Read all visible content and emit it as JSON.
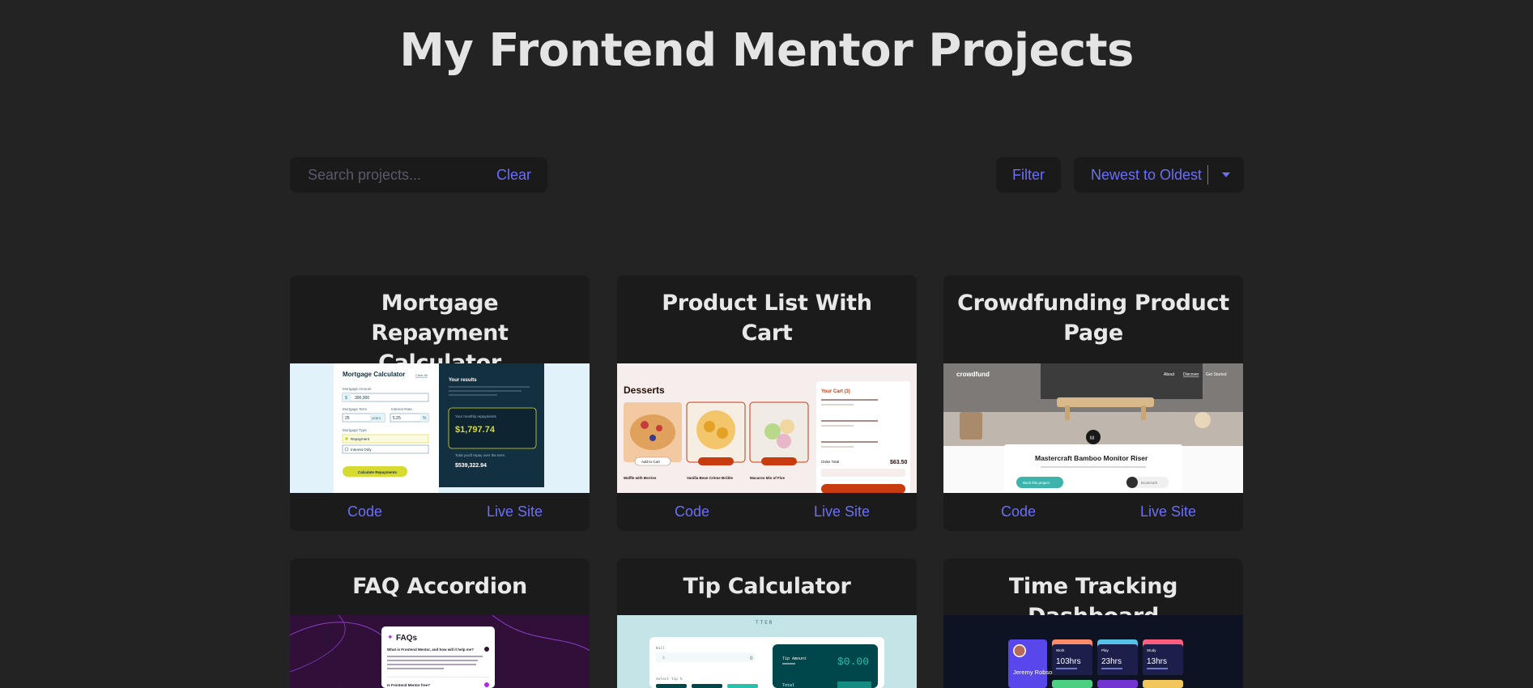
{
  "page": {
    "title": "My Frontend Mentor Projects"
  },
  "controls": {
    "search_placeholder": "Search projects...",
    "clear_label": "Clear",
    "filter_label": "Filter",
    "sort_selected": "Newest to Oldest"
  },
  "colors": {
    "background": "#232323",
    "card": "#1b1b1b",
    "accent": "#6b6ff7",
    "text": "#e6e6e6"
  },
  "projects": [
    {
      "title": "Mortgage Repayment Calculator",
      "code_label": "Code",
      "live_label": "Live Site",
      "preview": {
        "heading": "Mortgage Calculator",
        "clear_all": "Clear All",
        "amount_label": "Mortgage Amount",
        "amount_value": "300,000",
        "term_label": "Mortgage Term",
        "term_value": "25",
        "term_unit": "years",
        "rate_label": "Interest Rate",
        "rate_value": "5.25",
        "type_label": "Mortgage Type",
        "type_option_1": "Repayment",
        "type_option_2": "Interest Only",
        "button": "Calculate Repayments",
        "results_title": "Your results",
        "monthly_label": "Your monthly repayments",
        "monthly_value": "$1,797.74",
        "total_label": "Total you'll repay over the term",
        "total_value": "$539,322.94"
      }
    },
    {
      "title": "Product List With Cart",
      "code_label": "Code",
      "live_label": "Live Site",
      "preview": {
        "heading": "Desserts",
        "cart_title": "Your Cart (3)",
        "add_to_cart": "Add to Cart",
        "item_1": "Waffle with Berries",
        "item_2": "Vanilla Bean Crème Brûlée",
        "item_3": "Macaron Mix of Five",
        "order_total_label": "Order Total",
        "order_total": "$63.50"
      }
    },
    {
      "title": "Crowdfunding Product Page",
      "code_label": "Code",
      "live_label": "Live Site",
      "preview": {
        "brand": "crowdfund",
        "nav_1": "About",
        "nav_2": "Discover",
        "nav_3": "Get Started",
        "product": "Mastercraft Bamboo Monitor Riser",
        "back_button": "Back this project",
        "bookmark": "Bookmark"
      }
    },
    {
      "title": "FAQ Accordion",
      "preview": {
        "heading": "FAQs",
        "q1": "What is Frontend Mentor, and how will it help me?",
        "q2": "Is Frontend Mentor free?"
      }
    },
    {
      "title": "Tip Calculator",
      "preview": {
        "brand": "TTER",
        "bill_label": "Bill",
        "bill_value": "0",
        "tip_label": "Select Tip %",
        "tip_amount_label": "Tip Amount",
        "tip_amount_value": "$0.00",
        "total_label": "Total"
      }
    },
    {
      "title": "Time Tracking Dashboard",
      "preview": {
        "user_name": "Jeremy Robson",
        "card_1_title": "Work",
        "card_1_value": "103hrs",
        "card_2_title": "Play",
        "card_2_value": "23hrs",
        "card_3_title": "Study",
        "card_3_value": "13hrs"
      }
    }
  ]
}
